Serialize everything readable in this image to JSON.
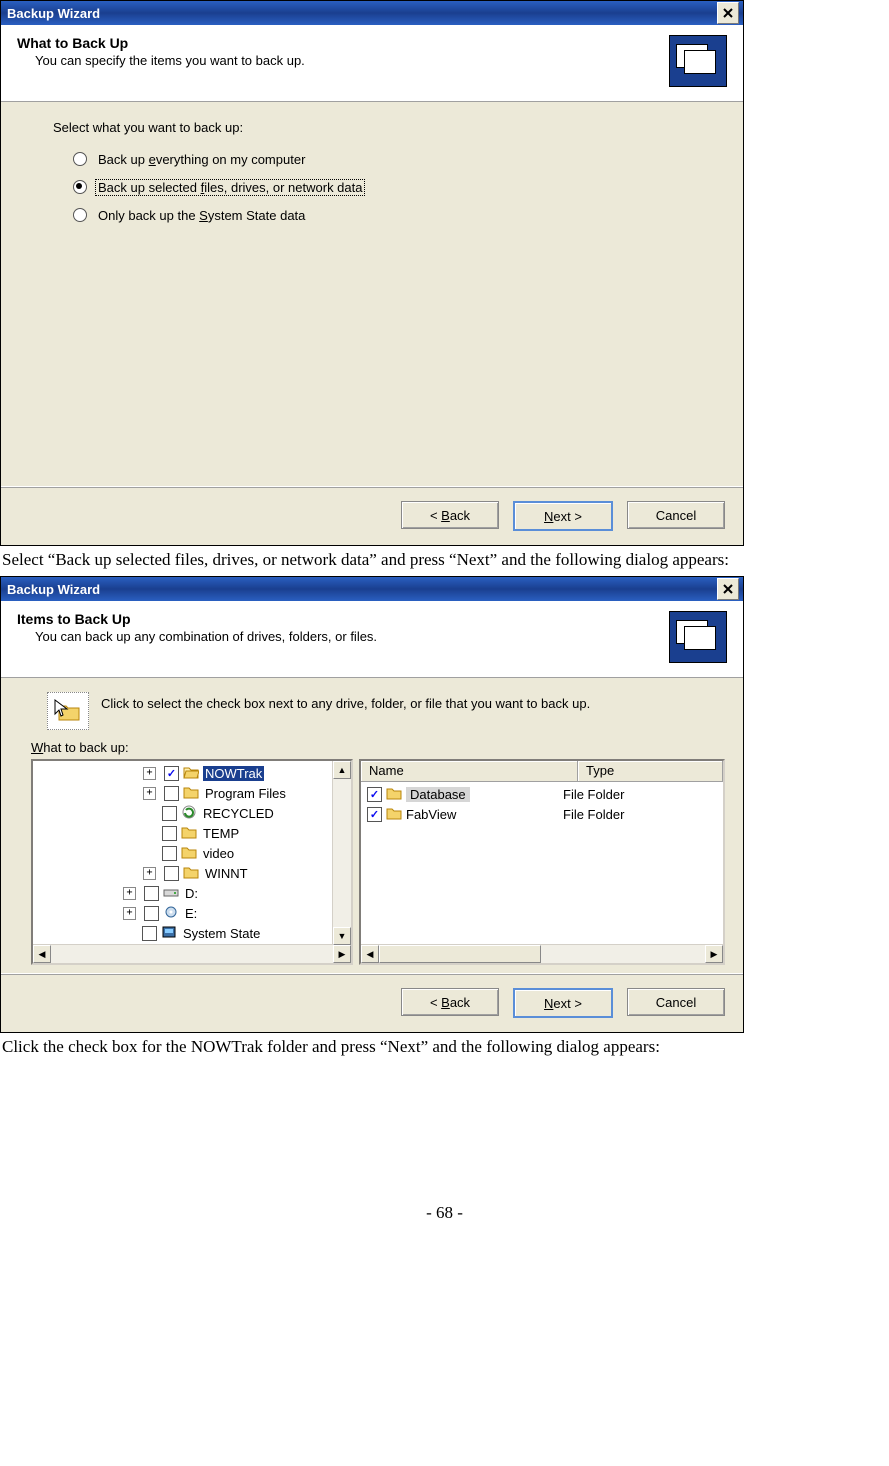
{
  "dialog1": {
    "title": "Backup Wizard",
    "header_title": "What to Back Up",
    "header_sub": "You can specify the items you want to back up.",
    "body_label": "Select what you want to back up:",
    "radios": [
      {
        "label_pre": "Back up ",
        "mn": "e",
        "label_post": "verything on my computer",
        "selected": false
      },
      {
        "label_pre": "Back up selected ",
        "mn": "f",
        "label_post": "iles, drives, or network data",
        "selected": true
      },
      {
        "label_pre": "Only back up the ",
        "mn": "S",
        "label_post": "ystem State data",
        "selected": false
      }
    ],
    "btn_back_pre": "< ",
    "btn_back_mn": "B",
    "btn_back_post": "ack",
    "btn_next_mn": "N",
    "btn_next_post": "ext >",
    "btn_cancel": "Cancel"
  },
  "caption1": "Select “Back up selected files, drives, or network data” and press “Next” and the following dialog appears:",
  "dialog2": {
    "title": "Backup Wizard",
    "header_title": "Items to Back Up",
    "header_sub": "You can back up any combination of drives, folders, or files.",
    "hint": "Click to select the check box next to any drive, folder, or file that you want to back up.",
    "section_label_mn": "W",
    "section_label_post": "hat to back up:",
    "tree": [
      {
        "indent": 1,
        "exp": "+",
        "checked": true,
        "icon": "folder",
        "label": "NOWTrak",
        "selected": true
      },
      {
        "indent": 1,
        "exp": "+",
        "checked": false,
        "icon": "folder",
        "label": "Program Files"
      },
      {
        "indent": 1,
        "exp": "",
        "checked": false,
        "icon": "recycle",
        "label": "RECYCLED"
      },
      {
        "indent": 1,
        "exp": "",
        "checked": false,
        "icon": "folder",
        "label": "TEMP"
      },
      {
        "indent": 1,
        "exp": "",
        "checked": false,
        "icon": "folder",
        "label": "video"
      },
      {
        "indent": 1,
        "exp": "+",
        "checked": false,
        "icon": "folder",
        "label": "WINNT"
      },
      {
        "indent": 0,
        "exp": "+",
        "checked": false,
        "icon": "drive",
        "label": "D:"
      },
      {
        "indent": 0,
        "exp": "+",
        "checked": false,
        "icon": "cddrive",
        "label": "E:"
      },
      {
        "indent": 0,
        "exp": "",
        "checked": false,
        "icon": "sysstate",
        "label": "System State"
      }
    ],
    "list_headers": {
      "name": "Name",
      "type": "Type"
    },
    "list_rows": [
      {
        "checked": true,
        "name": "Database",
        "type": "File Folder"
      },
      {
        "checked": true,
        "name": "FabView",
        "type": "File Folder"
      }
    ],
    "btn_back_pre": "< ",
    "btn_back_mn": "B",
    "btn_back_post": "ack",
    "btn_next_mn": "N",
    "btn_next_post": "ext >",
    "btn_cancel": "Cancel"
  },
  "caption2": "Click the check box for the NOWTrak folder and press “Next” and the following dialog appears:",
  "page_number": "- 68 -"
}
